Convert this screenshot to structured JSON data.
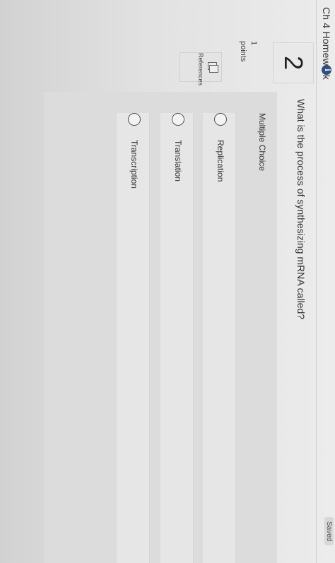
{
  "header": {
    "title": "Ch 4 Homework",
    "info_icon": "info-icon",
    "saved_label": "Saved"
  },
  "question": {
    "number": "2",
    "points_value": "1",
    "points_label": "points",
    "references_label": "References",
    "text": "What is the process of synthesizing mRNA called?",
    "type_label": "Multiple Choice",
    "options": [
      {
        "label": "Replication",
        "selected": false
      },
      {
        "label": "Translation",
        "selected": false
      },
      {
        "label": "Transcription",
        "selected": false
      }
    ]
  },
  "colors": {
    "badge": "#2d4f7c",
    "background": "#e6e6e6"
  }
}
